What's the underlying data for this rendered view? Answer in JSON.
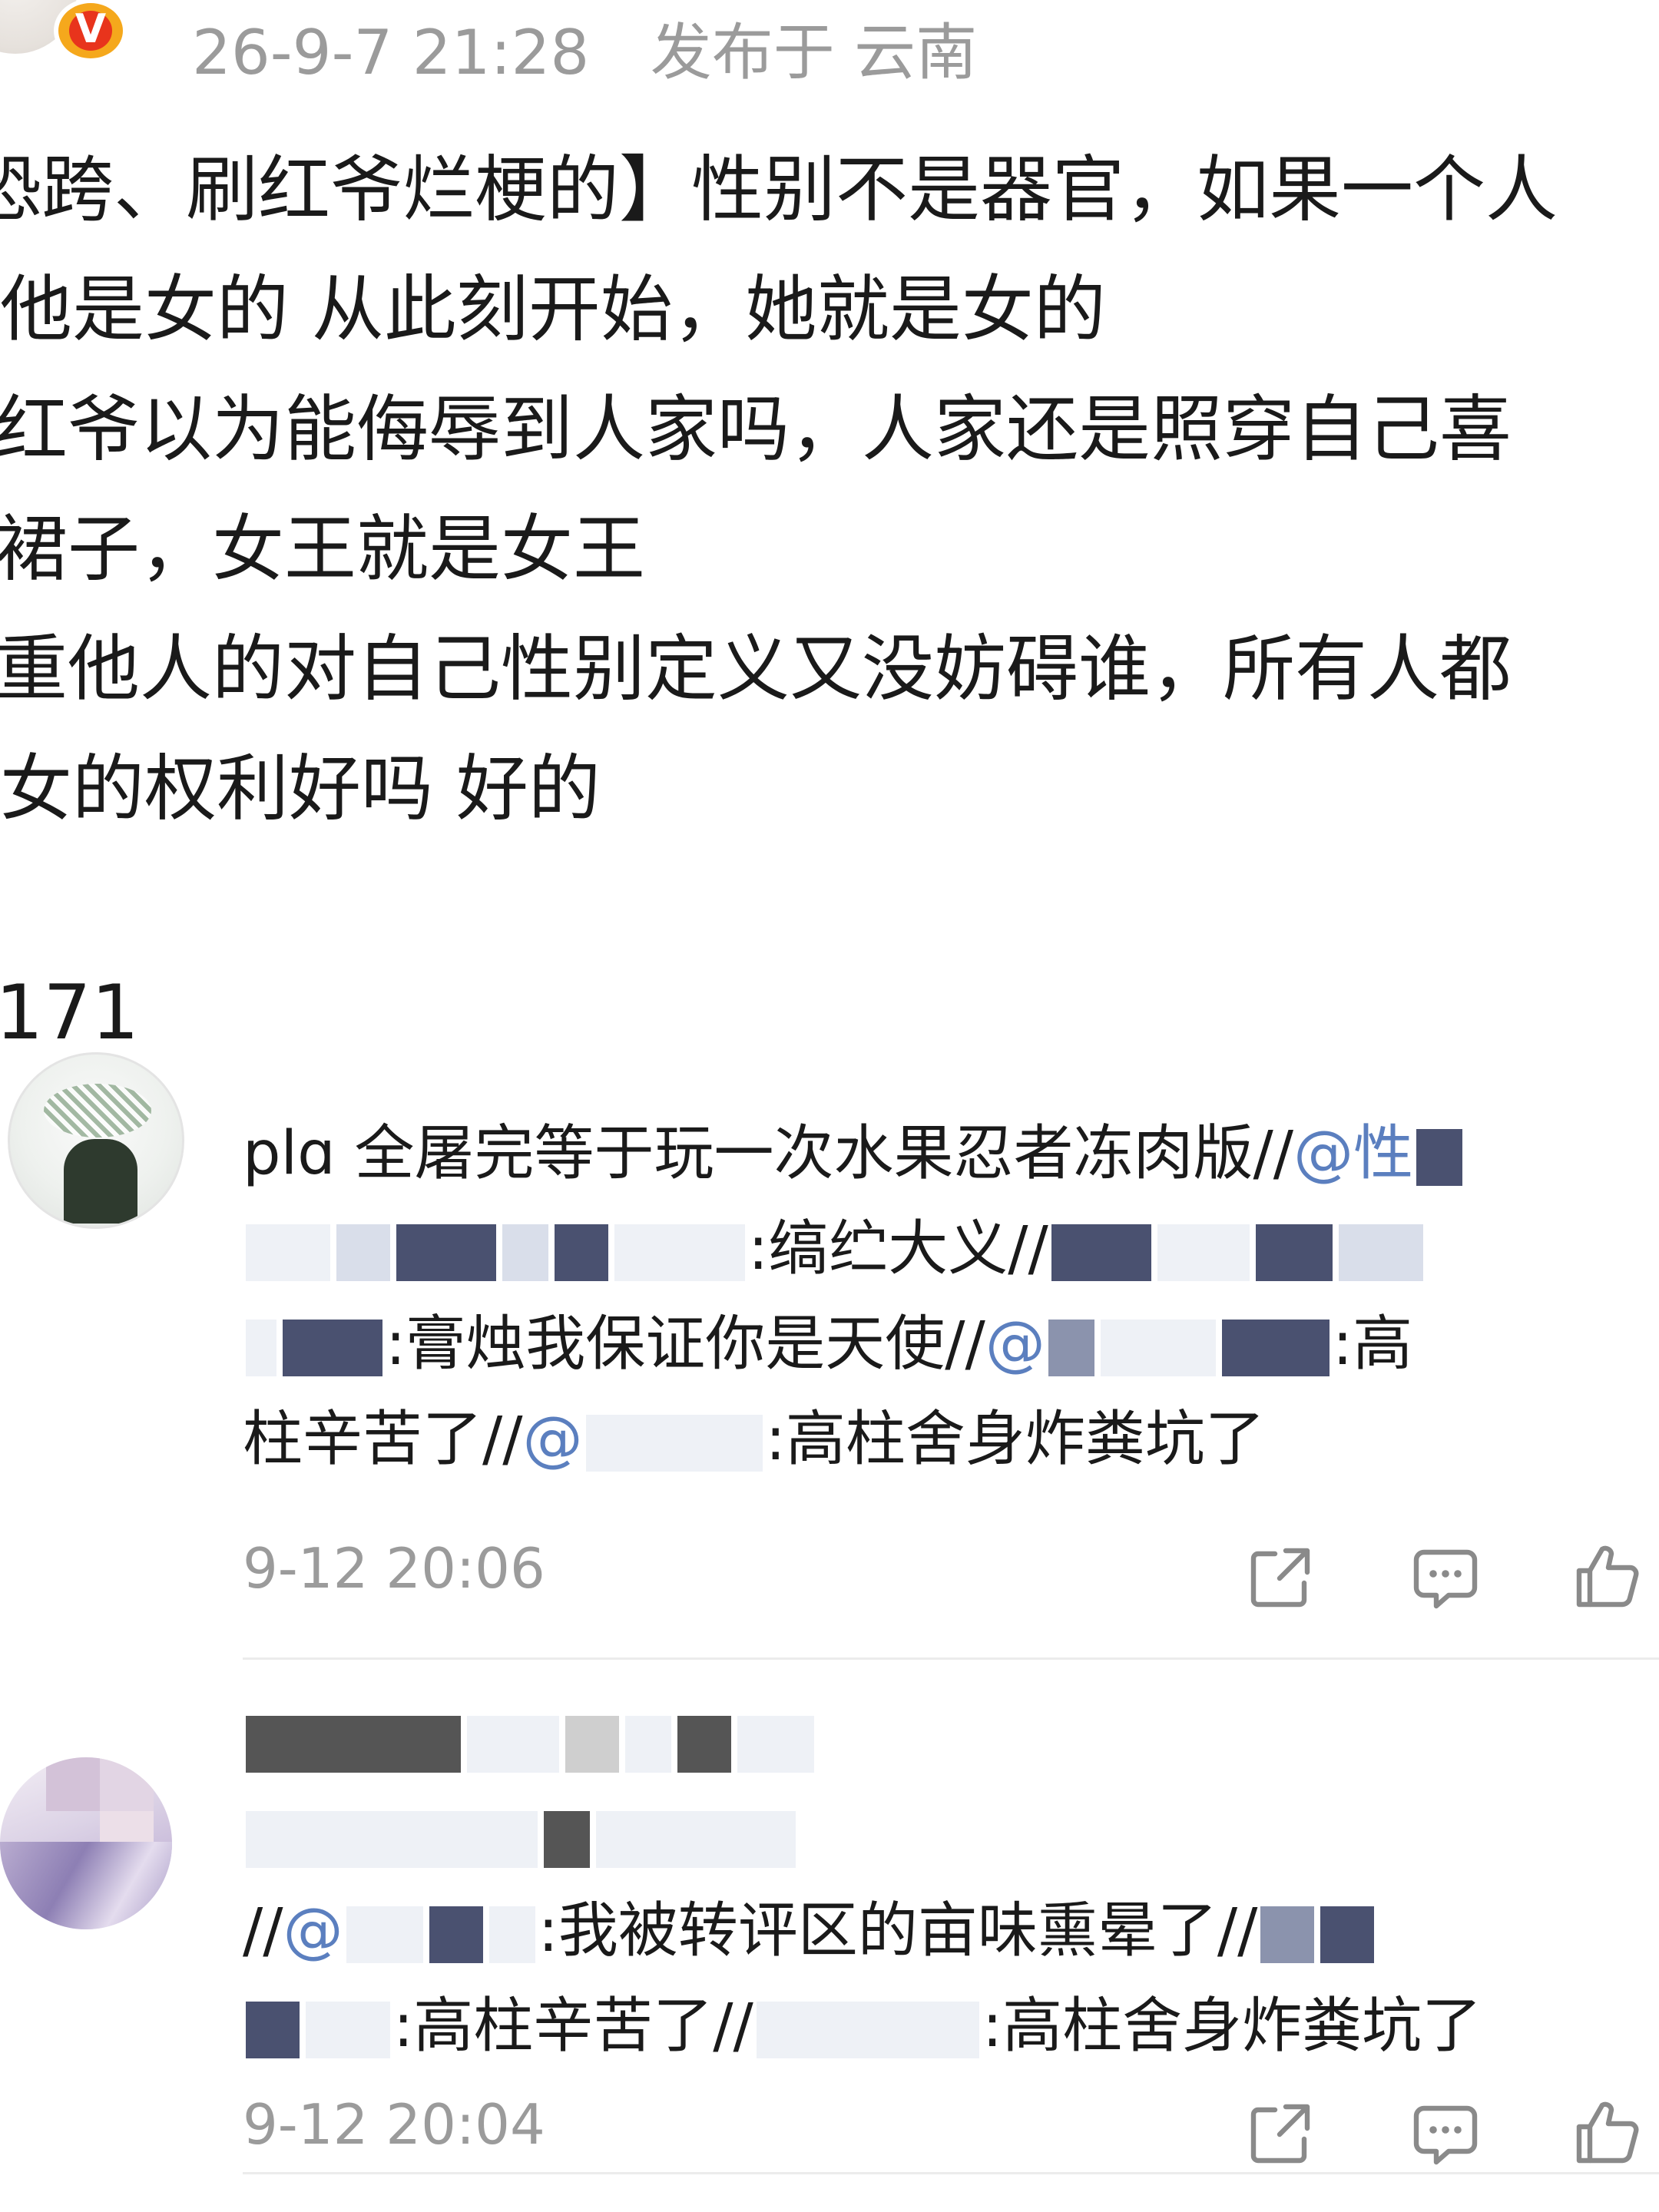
{
  "post": {
    "verified_badge": "V",
    "meta": {
      "time": "26-9-7 21:28",
      "location": "发布于 云南"
    },
    "lines": [
      "恐跨、刷红爷烂梗的】性别不是器官，如果一个人",
      "他是女的 从此刻开始，她就是女的",
      "红爷以为能侮辱到人家吗，人家还是照穿自己喜",
      "裙子，女王就是女王",
      "重他人的对自己性别定义又没妨碍谁，所有人都",
      "女的权利好吗 好的"
    ],
    "like_count": "171"
  },
  "comments": [
    {
      "avatar": "anime-character-avatar",
      "lines": {
        "l1_text": "plɑ 全屠完等于玩一次水果忍者冻肉版//",
        "l1_mention": "@",
        "l1_tail": "性",
        "l2_text": ":缟纻大义//",
        "l3_a": ":膏烛我保证你是天使//",
        "l3_mention": "@",
        "l3_b": ":高",
        "l4_a": "柱辛苦了//",
        "l4_mention": "@",
        "l4_b": ":高柱舍身炸粪坑了"
      },
      "time": "9-12 20:06"
    },
    {
      "avatar": "pixelated-avatar",
      "lines": {
        "l3_a": "//",
        "l3_mention": "@",
        "l3_b": ":我被转评区的亩味熏晕了//",
        "l4_a": ":高柱辛苦了//",
        "l4_b": ":高柱舍身炸粪坑了"
      },
      "time": "9-12 20:04"
    }
  ],
  "actions": {
    "share_icon": "share-icon",
    "comment_icon": "comment-icon",
    "like_icon": "thumbs-up-icon"
  },
  "colors": {
    "text": "#1a1a1a",
    "meta": "#9b9b9b",
    "mention": "#5b7fbf",
    "badge_outer": "#f5a81c",
    "badge_inner": "#e8341c",
    "icon_stroke": "#8a8a8a"
  }
}
